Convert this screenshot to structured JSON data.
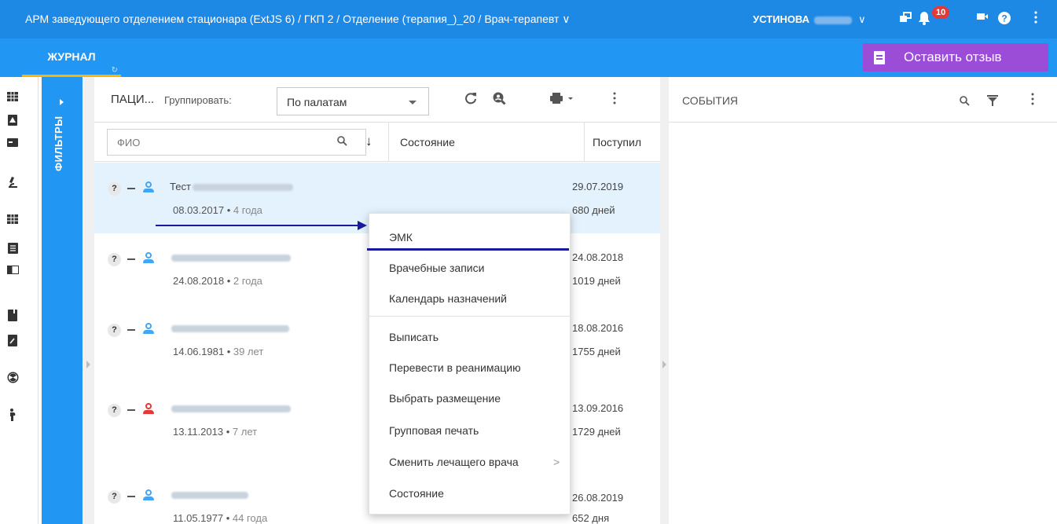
{
  "titlebar": {
    "title": "АРМ заведующего отделением стационара (ExtJS 6) / ГКП 2 / Отделение (терапия_)_20 / Врач-терапевт ∨",
    "user": "УСТИНОВА",
    "user_caret": "∨",
    "notifications_count": "10"
  },
  "tabs": {
    "journal": "ЖУРНАЛ"
  },
  "feedback": {
    "label": "Оставить отзыв"
  },
  "filters": {
    "label": "ФИЛЬТРЫ"
  },
  "patients_panel": {
    "title": "ПАЦИ...",
    "group_label": "Группировать:",
    "group_value": "По палатам",
    "search_placeholder": "ФИО",
    "col_state": "Состояние",
    "col_admitted": "Поступил"
  },
  "patients": [
    {
      "badge": "?",
      "name": "Тест",
      "dob": "08.03.2017",
      "age": "4 года",
      "admitted": "29.07.2019",
      "days": "680 дней",
      "gender_color": "#42a5f5"
    },
    {
      "badge": "?",
      "name": "",
      "dob": "24.08.2018",
      "age": "2 года",
      "admitted": "24.08.2018",
      "days": "1019 дней",
      "gender_color": "#42a5f5"
    },
    {
      "badge": "?",
      "name": "",
      "dob": "14.06.1981",
      "age": "39 лет",
      "admitted": "18.08.2016",
      "days": "1755 дней",
      "gender_color": "#42a5f5"
    },
    {
      "badge": "?",
      "name": "",
      "dob": "13.11.2013",
      "age": "7 лет",
      "admitted": "13.09.2016",
      "days": "1729 дней",
      "gender_color": "#e53935"
    },
    {
      "badge": "?",
      "name": "",
      "dob": "11.05.1977",
      "age": "44 года",
      "admitted": "26.08.2019",
      "days": "652 дня",
      "gender_color": "#42a5f5"
    }
  ],
  "events_panel": {
    "title": "СОБЫТИЯ"
  },
  "context_menu": {
    "items": [
      "ЭМК",
      "Врачебные записи",
      "Календарь назначений",
      "Выписать",
      "Перевести в реанимацию",
      "Выбрать размещение",
      "Групповая печать",
      "Сменить лечащего врача",
      "Состояние"
    ],
    "submenu_chevron": ">"
  },
  "colors": {
    "header_blue": "#1e88e5",
    "tabbar_blue": "#2196f3",
    "feedback_purple": "#9c4dd8",
    "selected_row": "#e3f2fd",
    "annotation": "#1a1aa0"
  }
}
